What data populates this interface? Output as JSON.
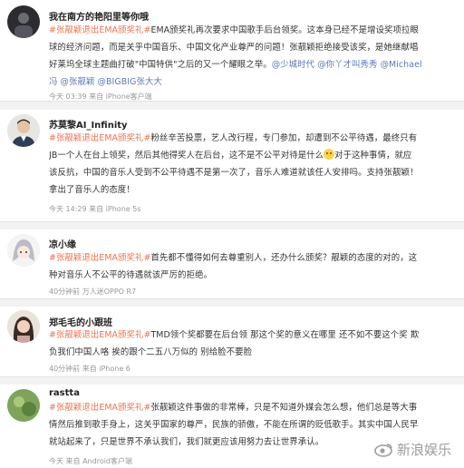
{
  "posts": [
    {
      "username": "我在南方的艳阳里等你哦",
      "avatar": "avatar-dark",
      "lines": [
        [
          {
            "t": "#张靓颖退出EMA颁奖礼#",
            "c": "tag"
          },
          {
            "t": "EMA颁奖礼再次要求中国歌手后台领奖。这本身已经不是增设奖项拉眼"
          }
        ],
        [
          {
            "t": "球的经济问题，而是关乎中国音乐、中国文化产业尊严的问题！张靓颖拒绝接受该奖，是她继献唱"
          }
        ],
        [
          {
            "t": "好莱坞全球主题曲打破\"中国特供\"之后的又一个耀眼之举。"
          },
          {
            "t": "@少城时代 @你丫才叫秀秀 @Michael",
            "c": "mention"
          }
        ],
        [
          {
            "t": "冯 @张靓颖 @BIGBIG张大大",
            "c": "mention"
          }
        ]
      ],
      "meta": "今天 03:39 来自 iPhone客户端"
    },
    {
      "username": "苏莫黎AI_Infinity",
      "avatar": "avatar-man",
      "lines": [
        [
          {
            "t": "#张靓颖退出EMA颁奖礼#",
            "c": "tag"
          },
          {
            "t": "粉丝辛苦投票，艺人改行程，专门参加，却遭到不公平待遇，最终只有"
          }
        ],
        [
          {
            "t": "JB一个人在台上领奖，然后其他得奖人在后台，这不是不公平对待是什么"
          },
          {
            "t": "",
            "c": "emoji"
          },
          {
            "t": "对于这种事情，就应"
          }
        ],
        [
          {
            "t": "该反抗，中国的音乐人受到不公平待遇不是第一次了，音乐人难道就该任人安排吗。支持张靓颖！"
          }
        ],
        [
          {
            "t": "拿出了音乐人的态度！"
          }
        ]
      ],
      "meta": "今天 14:29 来自 iPhone 5s"
    },
    {
      "username": "凉小缘",
      "avatar": "avatar-anime",
      "lines": [
        [
          {
            "t": "#张靓颖退出EMA颁奖礼#",
            "c": "tag"
          },
          {
            "t": "首先都不懂得如何去尊重别人，还办什么颁奖？靓颖的态度的对的，这"
          }
        ],
        [
          {
            "t": "种对音乐人不公平的待遇就该严厉的拒绝。"
          }
        ]
      ],
      "meta": "40分钟前 万人迷OPPO R7"
    },
    {
      "username": "郑毛毛的小跟班",
      "avatar": "avatar-girl",
      "lines": [
        [
          {
            "t": "#张靓颖退出EMA颁奖礼#",
            "c": "tag"
          },
          {
            "t": "TMD领个奖都要在后台领 那这个奖的意义在哪里 还不如不要这个奖 欺"
          }
        ],
        [
          {
            "t": "负我们中国人咯 挨的跟个二五八万似的 别给脸不要脸"
          }
        ]
      ],
      "meta": "40分钟前 来自 iPhone 6"
    },
    {
      "username": "rastta",
      "avatar": "avatar-green",
      "lines": [
        [
          {
            "t": "#张靓颖退出EMA颁奖礼#",
            "c": "tag"
          },
          {
            "t": "张靓颖这件事做的非常棒，只是不知道外媒会怎么想，他们总是等大事"
          }
        ],
        [
          {
            "t": "情然后推到歌手身上，这关乎国家的尊严，民族的骄傲，不能在所谓的贬低歌手。其实中国人民早"
          }
        ],
        [
          {
            "t": "就站起来了，只是世界不承认我们，我们就更应该用努力去让世界承认。"
          }
        ]
      ],
      "meta": "今天 来自 Android客户端"
    }
  ],
  "watermark": {
    "label": "新浪娱乐"
  }
}
